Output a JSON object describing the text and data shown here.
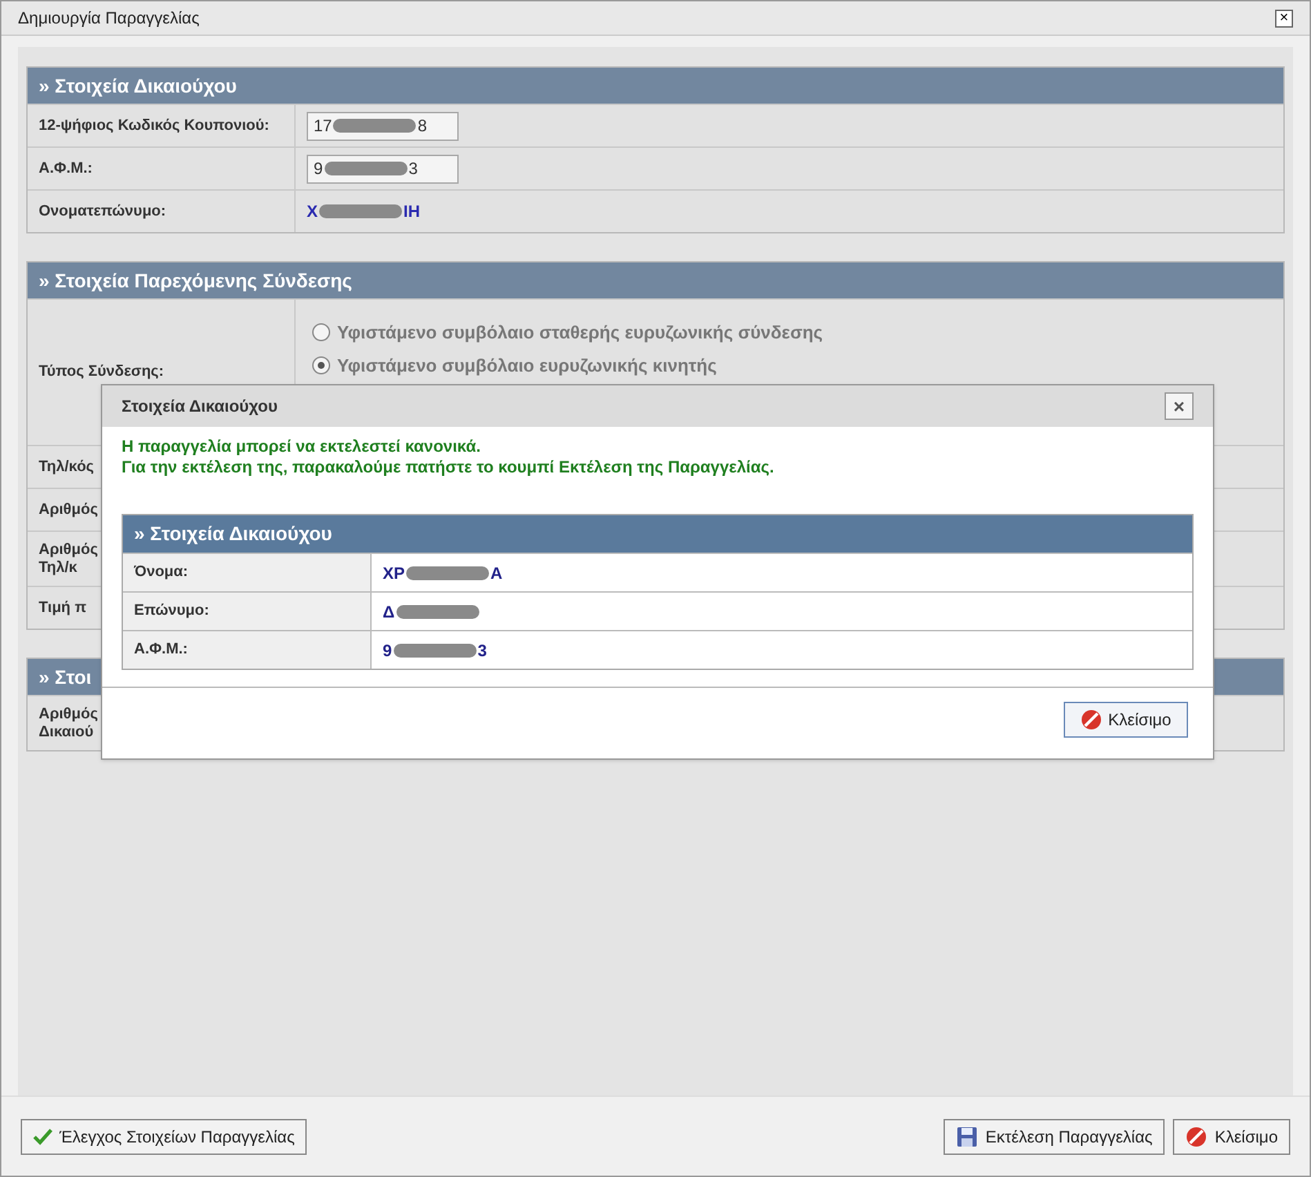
{
  "window": {
    "title": "Δημιουργία Παραγγελίας",
    "close": "×"
  },
  "sections": [
    {
      "title": "» Στοιχεία Δικαιούχου",
      "rows": [
        {
          "kind": "input",
          "label": "12-ψήφιος Κωδικός Κουπονιού:",
          "value_start": "17",
          "value_end": "8"
        },
        {
          "kind": "input",
          "label": "Α.Φ.Μ.:",
          "value_start": "9",
          "value_end": "3"
        },
        {
          "kind": "link",
          "label": "Ονοματεπώνυμο:",
          "value_start": "Χ",
          "value_end": "ΙΗ"
        }
      ]
    },
    {
      "title": "» Στοιχεία Παρεχόμενης Σύνδεσης",
      "rows": [
        {
          "kind": "radio",
          "label": "Τύπος Σύνδεσης:",
          "options": [
            {
              "label": "Υφιστάμενο συμβόλαιο σταθερής ευρυζωνικής σύνδεσης",
              "selected": false
            },
            {
              "label": "Υφιστάμενο συμβόλαιο ευρυζωνικής κινητής",
              "selected": true
            }
          ]
        },
        {
          "kind": "plain",
          "label": "Τηλ/κός"
        },
        {
          "kind": "plain",
          "label": "Αριθμός"
        },
        {
          "kind": "plain",
          "label": "Αριθμός Τηλ/κ"
        },
        {
          "kind": "plain",
          "label": "Τιμή π"
        }
      ]
    },
    {
      "title": "» Στοι",
      "rows": [
        {
          "kind": "plain",
          "label": "Αριθμός Δικαιού"
        }
      ]
    }
  ],
  "dialog": {
    "title": "Στοιχεία Δικαιούχου",
    "close": "×",
    "message": [
      "Η παραγγελία μπορεί να εκτελεστεί κανονικά.",
      "Για την εκτέλεση της, παρακαλούμε πατήστε το κουμπί Εκτέλεση της Παραγγελίας."
    ],
    "table": {
      "title": "» Στοιχεία Δικαιούχου",
      "rows": [
        {
          "label": "Όνομα:",
          "value_start": "ΧΡ",
          "value_end": "Α"
        },
        {
          "label": "Επώνυμο:",
          "value_start": "Δ",
          "value_end": ""
        },
        {
          "label": "Α.Φ.Μ.:",
          "value_start": "9",
          "value_end": "3"
        }
      ]
    },
    "button": "Κλείσιμο"
  },
  "footer": {
    "buttons": [
      {
        "kind": "check",
        "label": "Έλεγχος Στοιχείων Παραγγελίας"
      },
      {
        "kind": "save",
        "label": "Εκτέλεση Παραγγελίας"
      },
      {
        "kind": "cancel",
        "label": "Κλείσιμο"
      }
    ]
  }
}
